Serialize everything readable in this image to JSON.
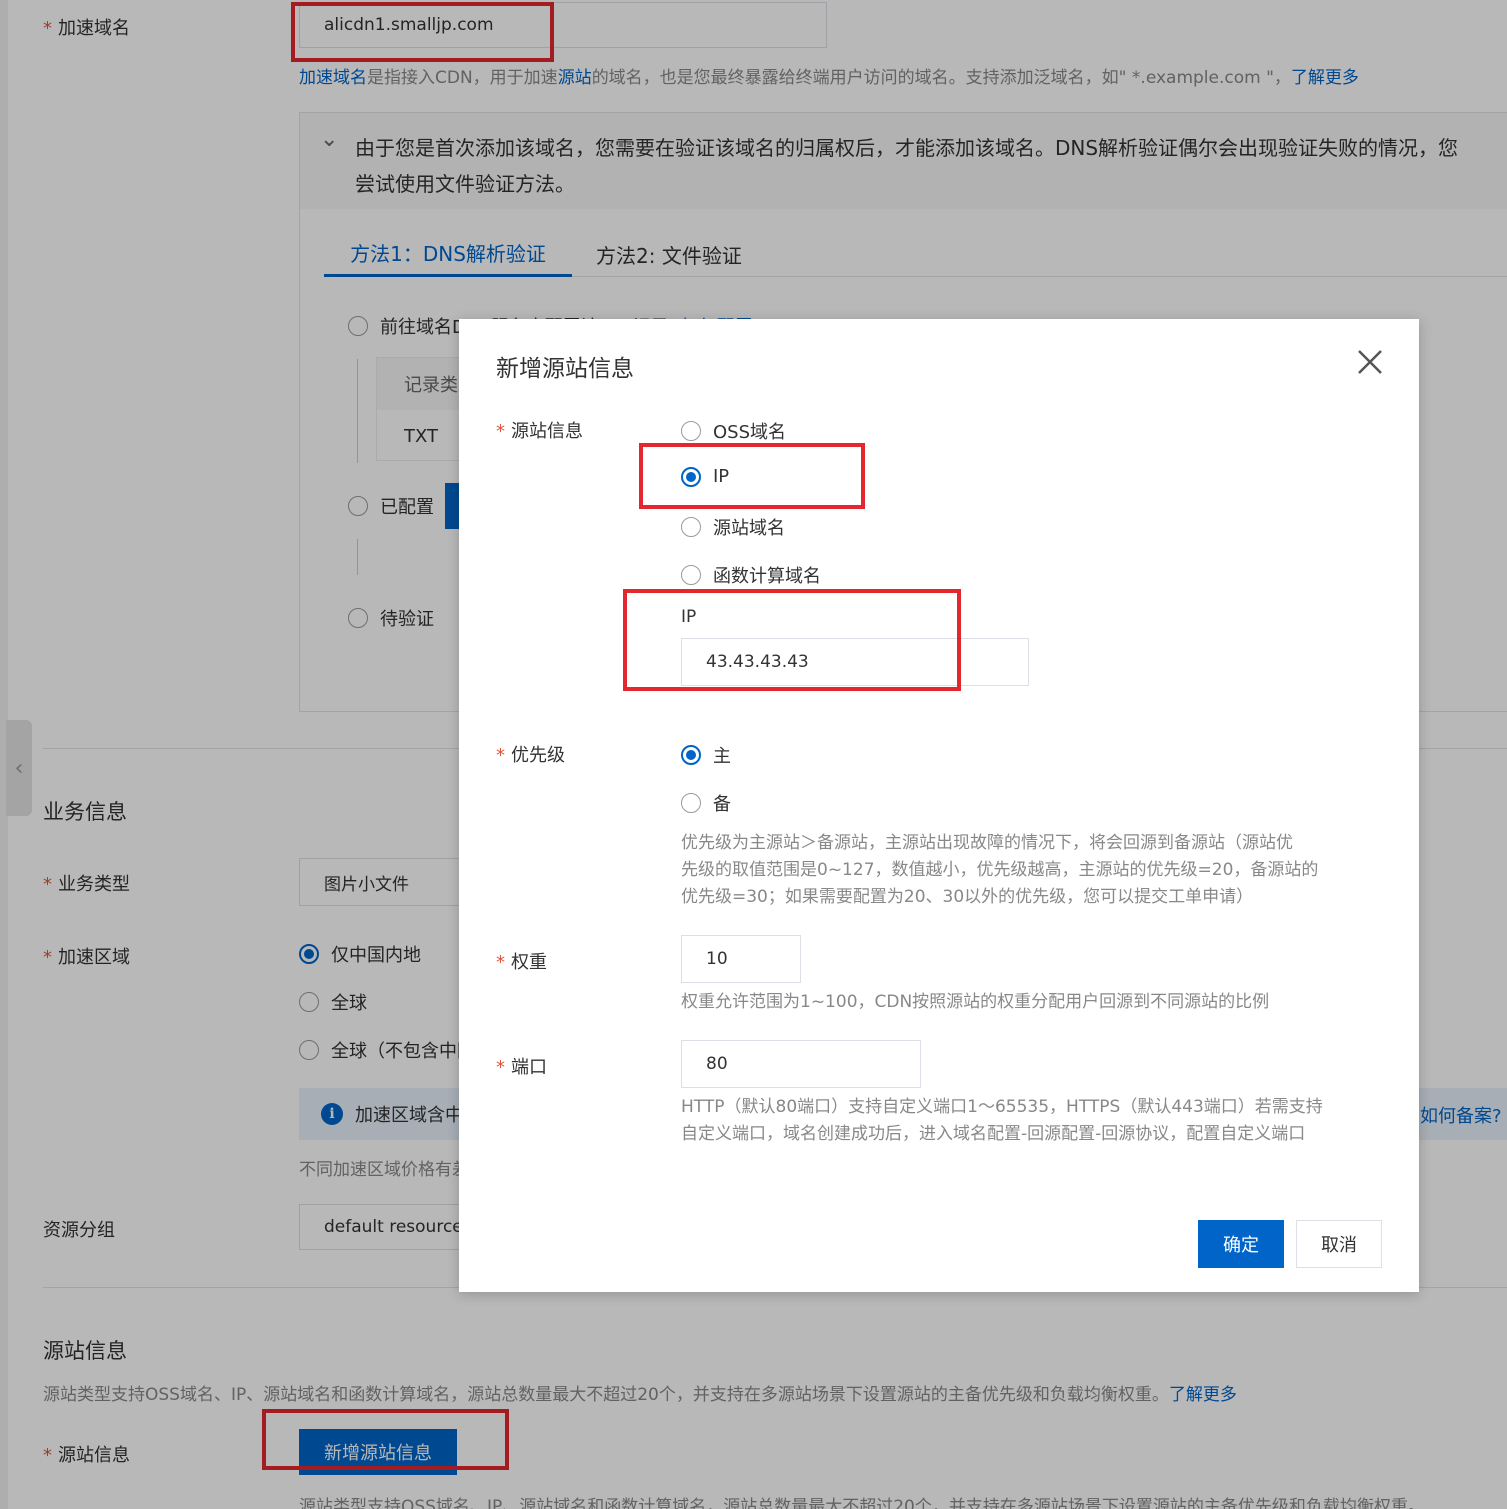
{
  "domain_section": {
    "label": "加速域名",
    "value": "alicdn1.smalljp.com",
    "help_prefix_link": "加速域名",
    "help_text_1": "是指接入CDN，用于加速",
    "help_link_2": "源站",
    "help_text_2": "的域名，也是您最终暴露给终端用户访问的域名。支持添加泛域名，如\" *.example.com \"，",
    "help_link_more": "了解更多"
  },
  "verify_panel": {
    "notice_line1": "由于您是首次添加该域名，您需要在验证该域名的归属权后，才能添加该域名。DNS解析验证偶尔会出现验证失败的情况，您",
    "notice_line2": "尝试使用文件验证方法。",
    "tabs": [
      {
        "label": "方法1：DNS解析验证",
        "active": true
      },
      {
        "label": "方法2: 文件验证",
        "active": false
      }
    ],
    "step1": "前往域名DNS服务商配置该TXT记录",
    "step1_link": "如何配置",
    "record_type_header": "记录类型",
    "record_type_value": "TXT",
    "step2": "已配置",
    "step3": "待验证"
  },
  "business_section": {
    "title": "业务信息",
    "type_label": "业务类型",
    "type_value": "图片小文件",
    "region_label": "加速区域",
    "region_options": [
      {
        "label": "仅中国内地",
        "selected": true
      },
      {
        "label": "全球",
        "selected": false
      },
      {
        "label": "全球（不包含中国内地）",
        "selected": false
      }
    ],
    "region_notice": "加速区域含中国内地，域名需已完成工信部备案",
    "region_notice_link": "如何备案?",
    "price_help": "不同加速区域价格有差异",
    "resource_group_label": "资源分组",
    "resource_group_value": "default resource group"
  },
  "origin_section": {
    "title": "源站信息",
    "help": "源站类型支持OSS域名、IP、源站域名和函数计算域名，源站总数量最大不超过20个，并支持在多源站场景下设置源站的主备优先级和负载均衡权重。",
    "help_link": "了解更多",
    "origin_label": "源站信息",
    "add_button": "新增源站信息",
    "bottom_help": "源站类型支持OSS域名、IP、源站域名和函数计算域名，源站总数量最大不超过20个，并支持在多源站场景下设置源站的主备优先级和负载均衡权重。"
  },
  "modal": {
    "title": "新增源站信息",
    "origin_info_label": "源站信息",
    "origin_types": [
      {
        "label": "OSS域名",
        "selected": false
      },
      {
        "label": "IP",
        "selected": true
      },
      {
        "label": "源站域名",
        "selected": false
      },
      {
        "label": "函数计算域名",
        "selected": false
      }
    ],
    "ip_label": "IP",
    "ip_value": "43.43.43.43",
    "priority_label": "优先级",
    "priority_options": [
      {
        "label": "主",
        "selected": true
      },
      {
        "label": "备",
        "selected": false
      }
    ],
    "priority_help_1": "优先级为主源站＞备源站，主源站出现故障的情况下，将会回源到备源站（源站优",
    "priority_help_2": "先级的取值范围是0~127，数值越小，优先级越高，主源站的优先级=20，备源站的",
    "priority_help_3": "优先级=30；如果需要配置为20、30以外的优先级，您可以提交工单申请）",
    "weight_label": "权重",
    "weight_value": "10",
    "weight_help": "权重允许范围为1~100，CDN按照源站的权重分配用户回源到不同源站的比例",
    "port_label": "端口",
    "port_value": "80",
    "port_help_1": "HTTP（默认80端口）支持自定义端口1～65535，HTTPS（默认443端口）若需支持",
    "port_help_2": "自定义端口，域名创建成功后，进入域名配置-回源配置-回源协议，配置自定义端口",
    "confirm_button": "确定",
    "cancel_button": "取消"
  },
  "colors": {
    "primary": "#0064c8",
    "required": "#e0533d",
    "highlight": "#e3262f"
  }
}
